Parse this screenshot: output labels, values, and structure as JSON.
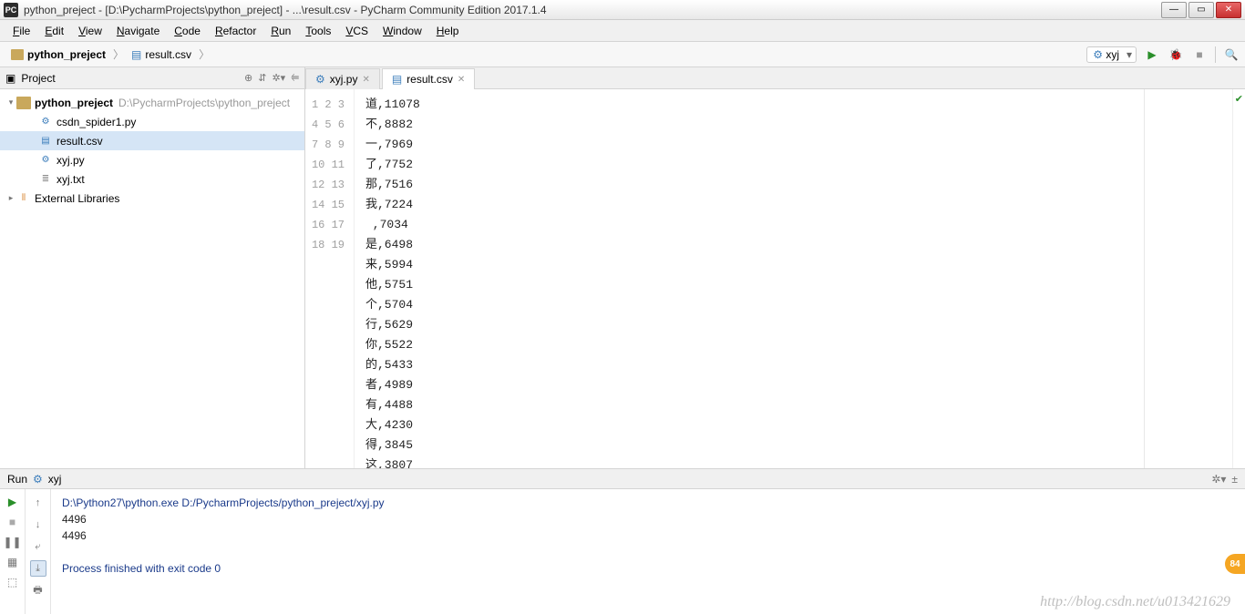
{
  "window": {
    "title": "python_preject - [D:\\PycharmProjects\\python_preject] - ...\\result.csv - PyCharm Community Edition 2017.1.4"
  },
  "menu": [
    "File",
    "Edit",
    "View",
    "Navigate",
    "Code",
    "Refactor",
    "Run",
    "Tools",
    "VCS",
    "Window",
    "Help"
  ],
  "breadcrumb": {
    "root": "python_preject",
    "file": "result.csv"
  },
  "run_config": "xyj",
  "project_header": {
    "title": "Project"
  },
  "tree": {
    "root": {
      "name": "python_preject",
      "path": "D:\\PycharmProjects\\python_preject"
    },
    "children": [
      {
        "name": "csdn_spider1.py",
        "kind": "py"
      },
      {
        "name": "result.csv",
        "kind": "csv",
        "selected": true
      },
      {
        "name": "xyj.py",
        "kind": "py"
      },
      {
        "name": "xyj.txt",
        "kind": "txt"
      }
    ],
    "external_libs": "External Libraries"
  },
  "tabs": [
    {
      "label": "xyj.py",
      "kind": "py",
      "active": false
    },
    {
      "label": "result.csv",
      "kind": "csv",
      "active": true
    }
  ],
  "editor_lines": [
    "道,11078",
    "不,8882",
    "一,7969",
    "了,7752",
    "那,7516",
    "我,7224",
    " ,7034",
    "是,6498",
    "来,5994",
    "他,5751",
    "个,5704",
    "行,5629",
    "你,5522",
    "的,5433",
    "者,4989",
    "有,4488",
    "大,4230",
    "得,3845",
    "这,3807"
  ],
  "run_panel": {
    "title_prefix": "Run",
    "title_config": "xyj",
    "lines": [
      {
        "cls": "cmd",
        "text": "D:\\Python27\\python.exe D:/PycharmProjects/python_preject/xyj.py"
      },
      {
        "cls": "out",
        "text": "4496"
      },
      {
        "cls": "out",
        "text": "4496"
      },
      {
        "cls": "blank",
        "text": ""
      },
      {
        "cls": "cmd",
        "text": "Process finished with exit code 0"
      }
    ]
  },
  "badge": "84",
  "watermark": "http://blog.csdn.net/u013421629"
}
